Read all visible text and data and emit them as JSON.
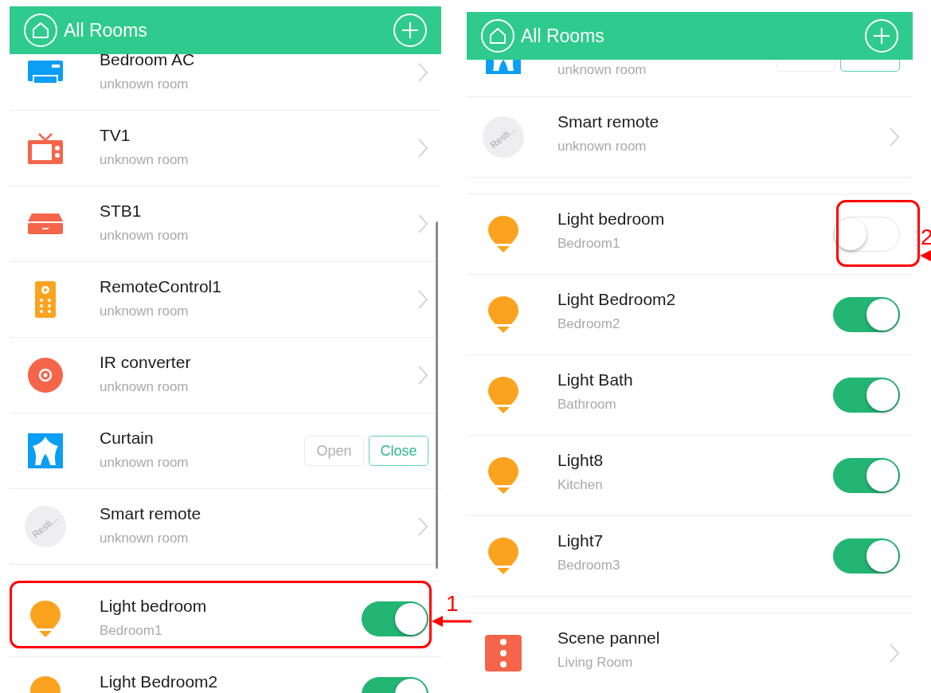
{
  "panels": [
    {
      "header": {
        "title": "All Rooms"
      },
      "sections": [
        {
          "items": [
            {
              "kind": "ac",
              "name": "Bedroom AC",
              "room": "unknown room"
            },
            {
              "kind": "tv",
              "name": "TV1",
              "room": "unknown room"
            },
            {
              "kind": "stb",
              "name": "STB1",
              "room": "unknown room"
            },
            {
              "kind": "remote",
              "name": "RemoteControl1",
              "room": "unknown room"
            },
            {
              "kind": "ir",
              "name": "IR converter",
              "room": "unknown room"
            },
            {
              "kind": "curtain",
              "name": "Curtain",
              "room": "unknown room",
              "actions": [
                {
                  "label": "Open",
                  "disabled": true
                },
                {
                  "label": "Close",
                  "disabled": false
                }
              ]
            },
            {
              "kind": "avatar",
              "avatar_text": "Resti...",
              "name": "Smart remote",
              "room": "unknown room"
            }
          ]
        },
        {
          "items": [
            {
              "kind": "bulb",
              "name": "Light bedroom",
              "room": "Bedroom1",
              "on": true
            },
            {
              "kind": "bulb",
              "name": "Light Bedroom2",
              "on": true
            }
          ]
        }
      ]
    },
    {
      "header": {
        "title": "All Rooms"
      },
      "sections": [
        {
          "items": [
            {
              "kind": "curtain",
              "room": "unknown room",
              "actions": [
                {
                  "disabled": true
                },
                {
                  "disabled": false
                }
              ]
            },
            {
              "kind": "avatar",
              "avatar_text": "Resti...",
              "name": "Smart remote",
              "room": "unknown room"
            }
          ]
        },
        {
          "items": [
            {
              "kind": "bulb",
              "name": "Light bedroom",
              "room": "Bedroom1",
              "on": false
            },
            {
              "kind": "bulb",
              "name": "Light Bedroom2",
              "room": "Bedroom2",
              "on": true
            },
            {
              "kind": "bulb",
              "name": "Light Bath",
              "room": "Bathroom",
              "on": true
            },
            {
              "kind": "bulb",
              "name": "Light8",
              "room": "Kitchen",
              "on": true
            },
            {
              "kind": "bulb",
              "name": "Light7",
              "room": "Bedroom3",
              "on": true
            }
          ]
        },
        {
          "items": [
            {
              "kind": "scene",
              "name": "Scene pannel",
              "room": "Living Room"
            }
          ]
        }
      ]
    }
  ],
  "annotations": [
    {
      "label": "1"
    },
    {
      "label": "2"
    }
  ]
}
